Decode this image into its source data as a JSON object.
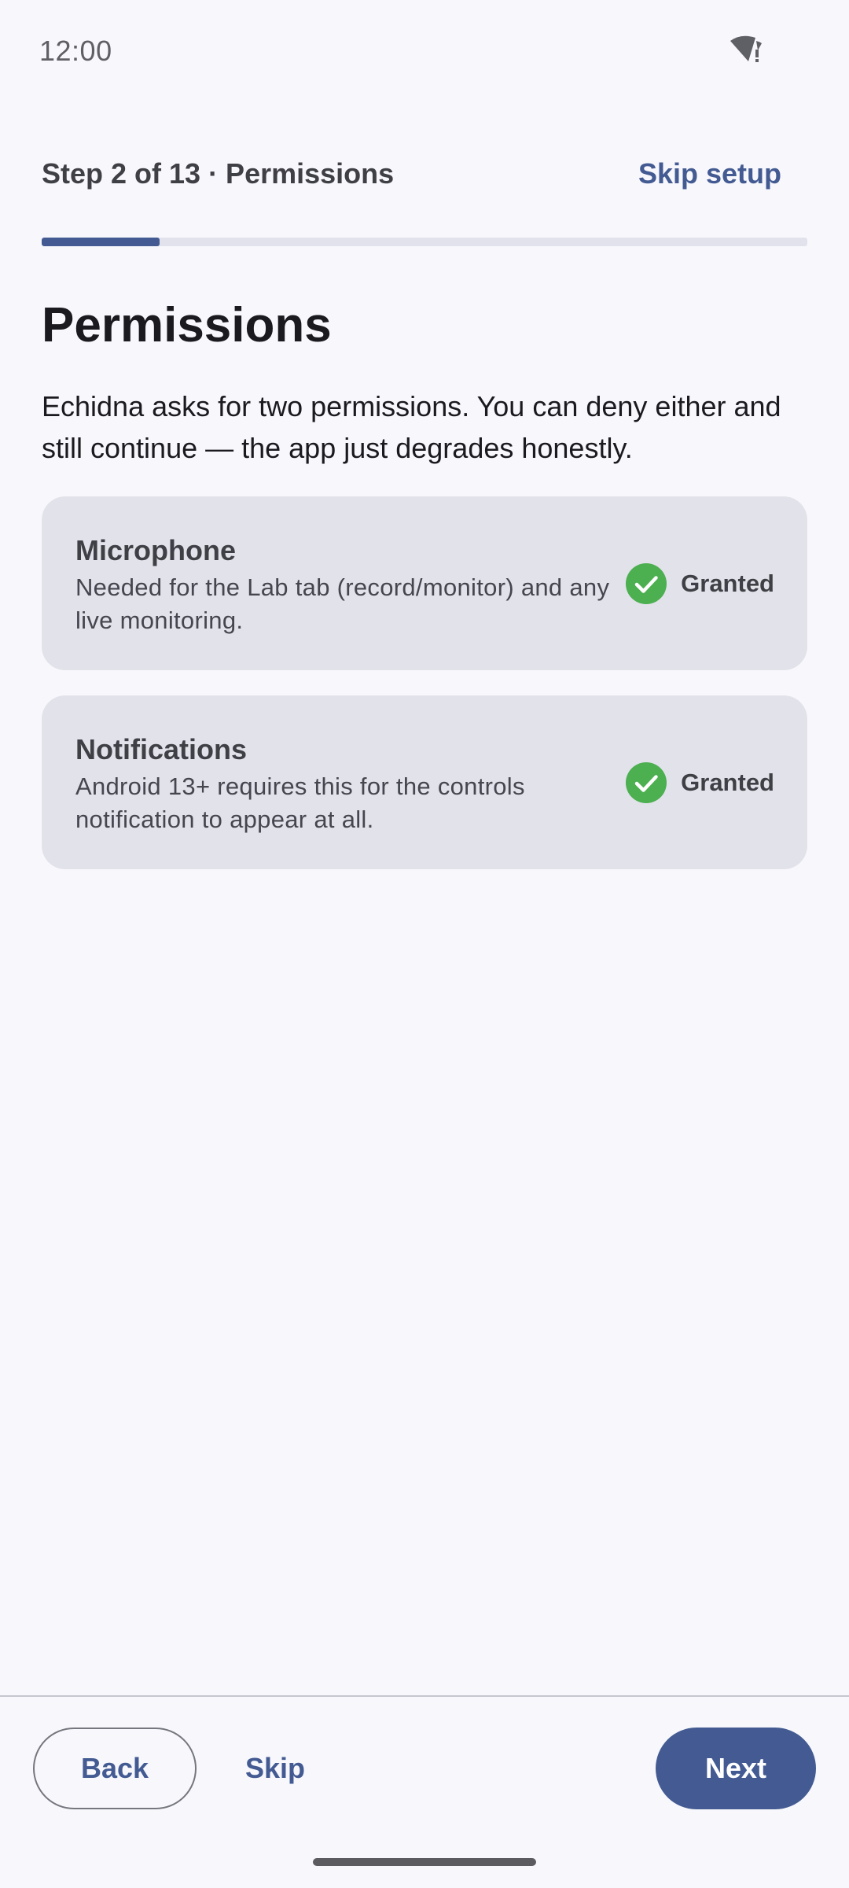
{
  "status_bar": {
    "time": "12:00",
    "wifi_icon": "wifi-alert-icon"
  },
  "header": {
    "step_label": "Step 2 of 13 · Permissions",
    "skip_setup_label": "Skip setup",
    "progress_fraction": 0.1538
  },
  "main": {
    "title": "Permissions",
    "intro": "Echidna asks for two permissions. You can deny either and still continue — the app just degrades honestly.",
    "permissions": [
      {
        "title": "Microphone",
        "description": "Needed for the Lab tab (record/monitor) and any live monitoring.",
        "status": "Granted",
        "status_icon": "check-circle-icon"
      },
      {
        "title": "Notifications",
        "description": "Android 13+ requires this for the controls notification to appear at all.",
        "status": "Granted",
        "status_icon": "check-circle-icon"
      }
    ]
  },
  "footer": {
    "back_label": "Back",
    "skip_label": "Skip",
    "next_label": "Next"
  },
  "colors": {
    "accent": "#435b92",
    "background": "#f8f8fc",
    "card": "#e2e2ea",
    "granted": "#4caf50"
  }
}
